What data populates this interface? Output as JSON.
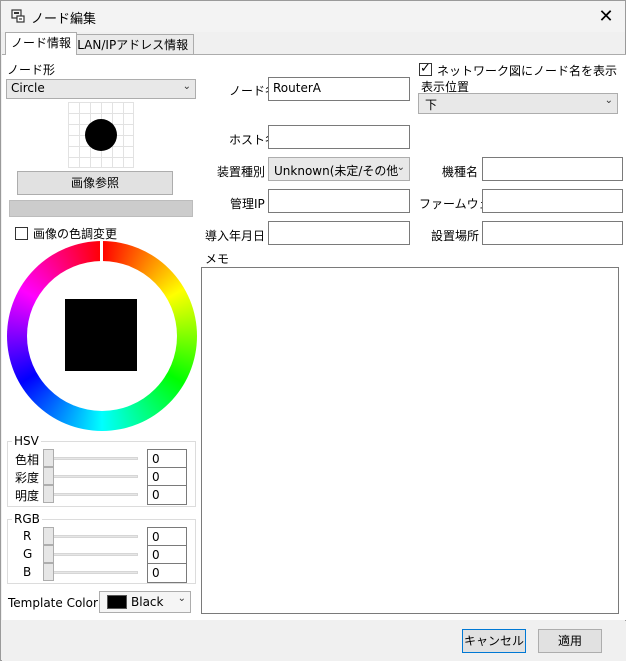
{
  "window": {
    "title": "ノード編集",
    "close_symbol": "✕",
    "icon": "node-edit-icon"
  },
  "tabs": [
    {
      "label": "ノード情報",
      "active": true
    },
    {
      "label": "VLAN/IPアドレス情報",
      "active": false
    }
  ],
  "left": {
    "shape_label": "ノード形",
    "shape_value": "Circle",
    "image_button": "画像参照",
    "tint_checkbox_label": "画像の色調変更",
    "tint_checked": false,
    "hsv": {
      "title": "HSV",
      "rows": [
        {
          "label": "色相",
          "value": "0"
        },
        {
          "label": "彩度",
          "value": "0"
        },
        {
          "label": "明度",
          "value": "0"
        }
      ]
    },
    "rgb": {
      "title": "RGB",
      "rows": [
        {
          "label": "R",
          "value": "0"
        },
        {
          "label": "G",
          "value": "0"
        },
        {
          "label": "B",
          "value": "0"
        }
      ]
    },
    "template_label": "Template Color:",
    "template_value": "Black",
    "template_swatch": "#000000"
  },
  "form": {
    "node_name_label": "ノード名",
    "node_name_value": "RouterA",
    "show_name_label": "ネットワーク図にノード名を表示",
    "show_name_checked": true,
    "display_pos_label": "表示位置",
    "display_pos_value": "下",
    "host_label": "ホスト名",
    "host_value": "",
    "device_type_label": "装置種別",
    "device_type_value": "Unknown(未定/その他",
    "model_label": "機種名",
    "model_value": "",
    "mgmt_ip_label": "管理IP",
    "mgmt_ip_value": "",
    "firmware_label": "ファームウェア",
    "firmware_value": "",
    "intro_date_label": "導入年月日",
    "intro_date_value": "",
    "location_label": "設置場所",
    "location_value": "",
    "memo_label": "メモ",
    "memo_value": ""
  },
  "buttons": {
    "cancel": "キャンセル",
    "apply": "適用"
  }
}
